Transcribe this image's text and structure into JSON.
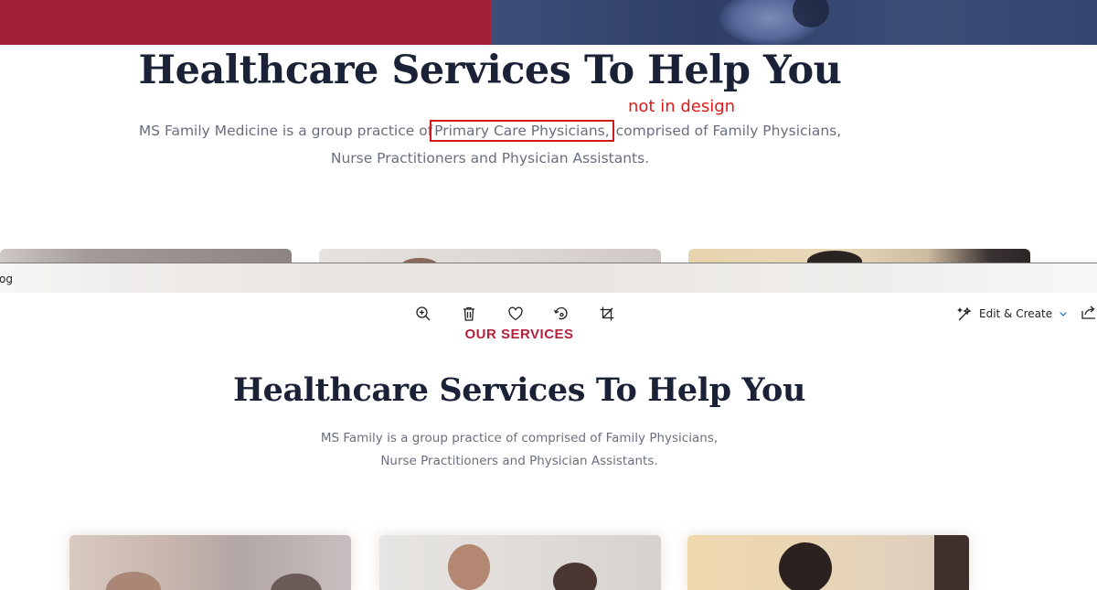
{
  "top_section": {
    "heading": "Healthcare Services To Help You",
    "para_line1_before": "MS Family Medicine is a group practice of",
    "para_line1_highlight": "Primary Care Physicians,",
    "para_line1_after": "comprised of Family Physicians,",
    "para_line2": "Nurse Practitioners and Physician Assistants.",
    "annotation": "not in design",
    "colors": {
      "banner_red": "#a11f38",
      "annotation_red": "#e01919",
      "heading": "#1b2136",
      "body_text": "#6a6f7f"
    }
  },
  "viewer": {
    "file_name_fragment": "og",
    "toolbar": {
      "zoom_icon": "zoom-in-icon",
      "delete_icon": "trash-icon",
      "favorite_icon": "heart-icon",
      "rotate_icon": "rotate-icon",
      "crop_icon": "crop-icon",
      "edit_create_label": "Edit & Create",
      "share_icon": "share-icon",
      "accent": "#0067c0"
    },
    "design": {
      "eyebrow": "OUR SERVICES",
      "heading": "Healthcare Services To Help You",
      "para_line1": "MS Family is a group practice of  comprised of Family Physicians,",
      "para_line2": "Nurse Practitioners and Physician Assistants.",
      "eyebrow_color": "#b3213d"
    }
  }
}
